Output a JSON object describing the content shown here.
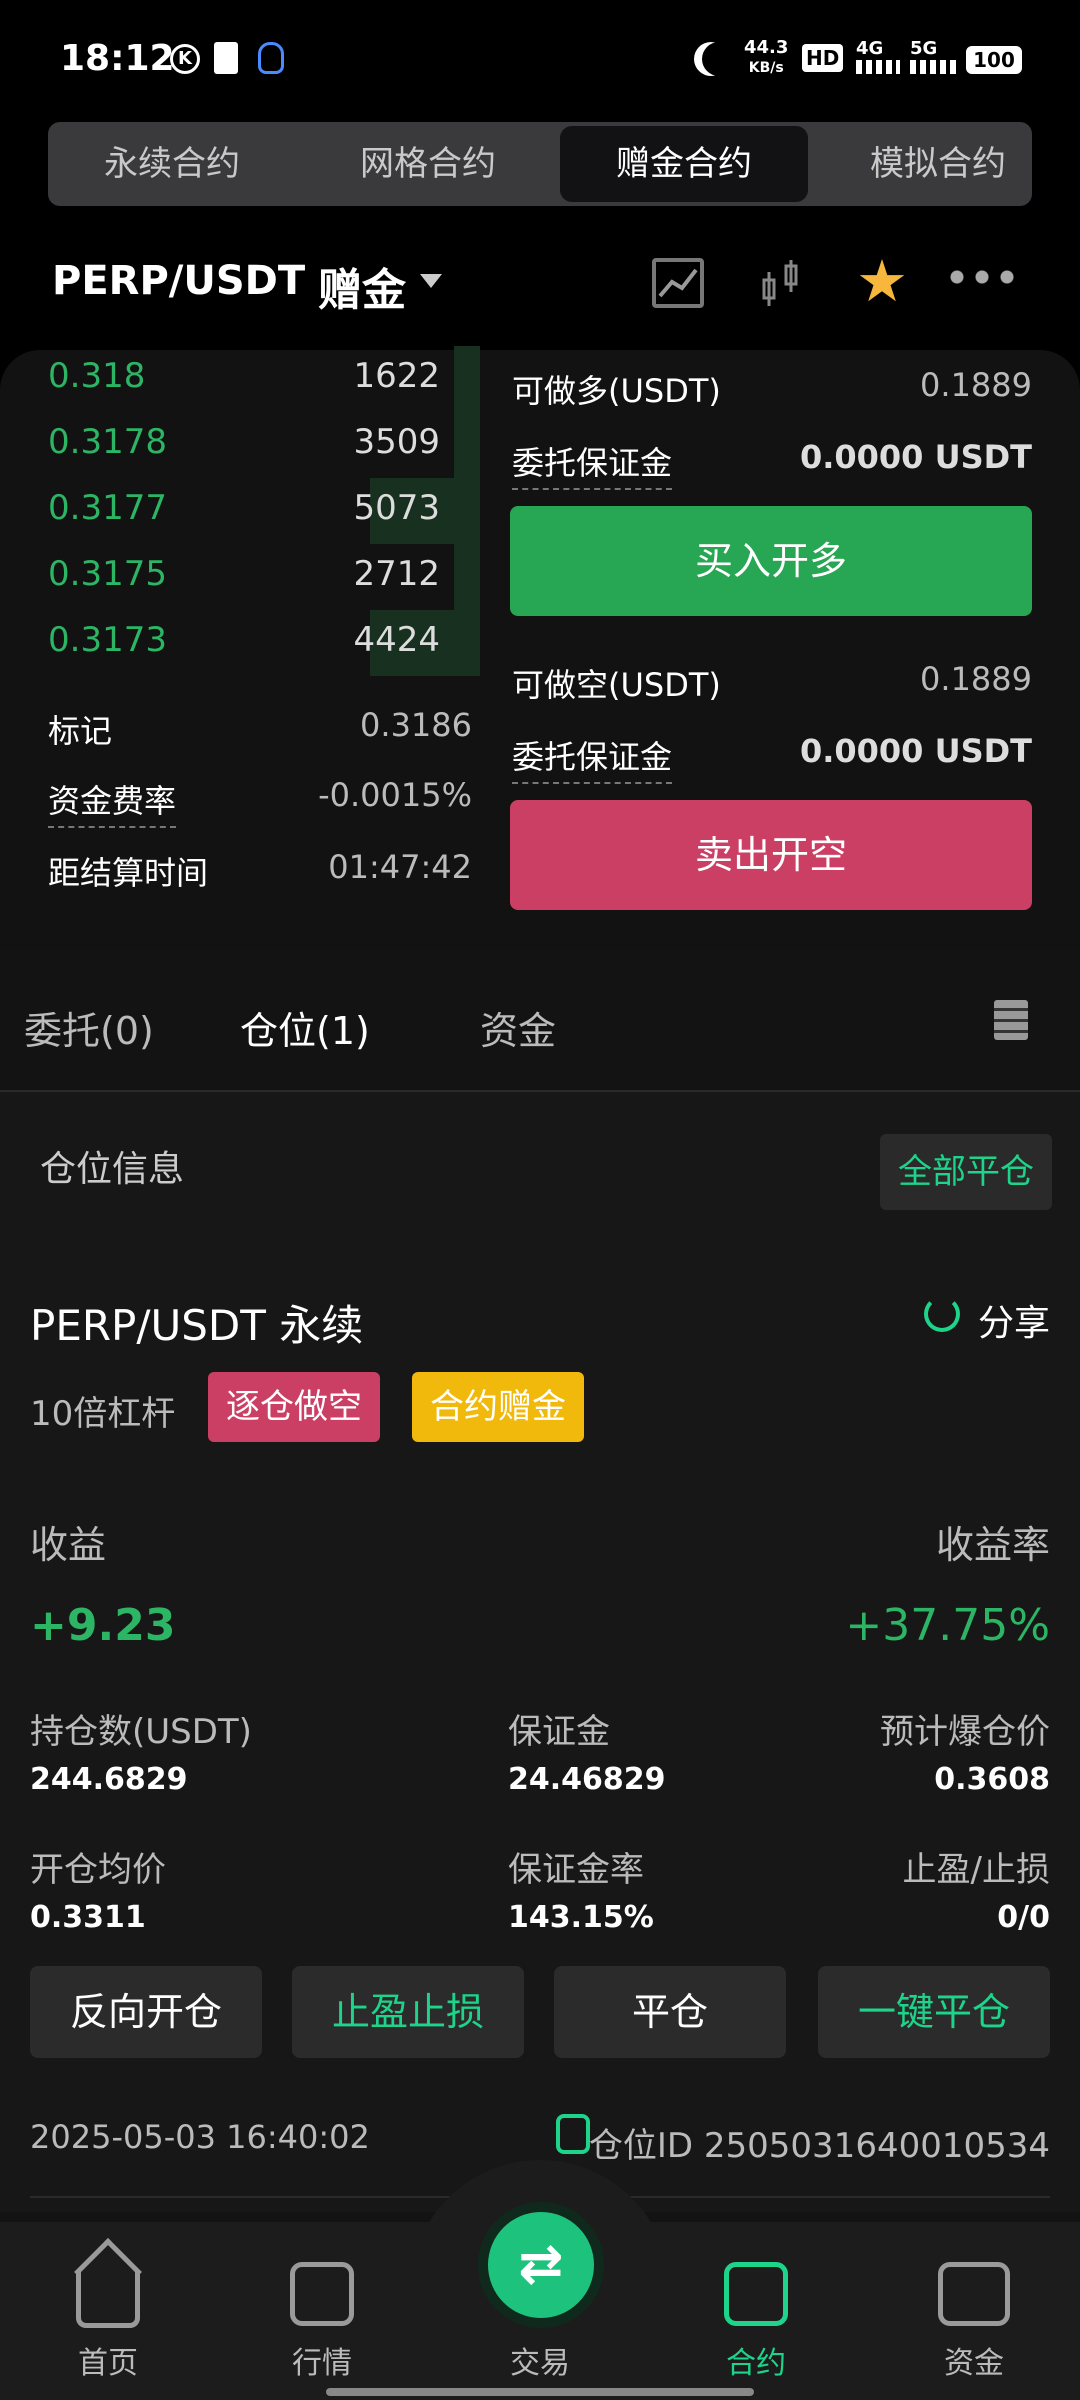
{
  "status": {
    "time": "18:12",
    "net_speed": "44.3",
    "net_unit": "KB/s",
    "hd": "HD",
    "signal1": "4G",
    "signal2": "5G",
    "battery": "100"
  },
  "tabs": [
    {
      "label": "永续合约"
    },
    {
      "label": "网格合约"
    },
    {
      "label": "赠金合约"
    },
    {
      "label": "模拟合约"
    }
  ],
  "header": {
    "pair": "PERP/USDT",
    "gift": "赠金"
  },
  "orderbook": [
    {
      "price": "0.318",
      "qty": "1622"
    },
    {
      "price": "0.3178",
      "qty": "3509"
    },
    {
      "price": "0.3177",
      "qty": "5073"
    },
    {
      "price": "0.3175",
      "qty": "2712"
    },
    {
      "price": "0.3173",
      "qty": "4424"
    }
  ],
  "info": {
    "mark_label": "标记",
    "mark_val": "0.3186",
    "funding_label": "资金费率",
    "funding_val": "-0.0015%",
    "settle_label": "距结算时间",
    "settle_val": "01:47:42"
  },
  "long": {
    "avail_label": "可做多(USDT)",
    "avail_val": "0.1889",
    "margin_label": "委托保证金",
    "margin_val": "0.0000 USDT",
    "button": "买入开多"
  },
  "short": {
    "avail_label": "可做空(USDT)",
    "avail_val": "0.1889",
    "margin_label": "委托保证金",
    "margin_val": "0.0000 USDT",
    "button": "卖出开空"
  },
  "subtabs": {
    "orders": "委托(0)",
    "positions": "仓位(1)",
    "funds": "资金"
  },
  "position": {
    "section_title": "仓位信息",
    "close_all": "全部平仓",
    "name": "PERP/USDT 永续",
    "share": "分享",
    "leverage": "10倍杠杆",
    "tag1": "逐仓做空",
    "tag2": "合约赠金",
    "pnl_label": "收益",
    "pnl_val": "+9.23",
    "roe_label": "收益率",
    "roe_val": "+37.75%",
    "size_label": "持仓数(USDT)",
    "size_val": "244.6829",
    "margin_label": "保证金",
    "margin_val": "24.46829",
    "liq_label": "预计爆仓价",
    "liq_val": "0.3608",
    "entry_label": "开仓均价",
    "entry_val": "0.3311",
    "mr_label": "保证金率",
    "mr_val": "143.15%",
    "tpsl_label": "止盈/止损",
    "tpsl_val": "0/0",
    "btn_reverse": "反向开仓",
    "btn_tpsl": "止盈止损",
    "btn_close": "平仓",
    "btn_close_all": "一键平仓",
    "time": "2025-05-03 16:40:02",
    "id_label": "仓位ID 2505031640010534"
  },
  "nav": [
    {
      "label": "首页"
    },
    {
      "label": "行情"
    },
    {
      "label": "交易"
    },
    {
      "label": "合约"
    },
    {
      "label": "资金"
    }
  ],
  "colors": {
    "green": "#2cb564",
    "red": "#cc3f64",
    "yellow": "#f0b90b",
    "accent": "#1dd48a"
  }
}
